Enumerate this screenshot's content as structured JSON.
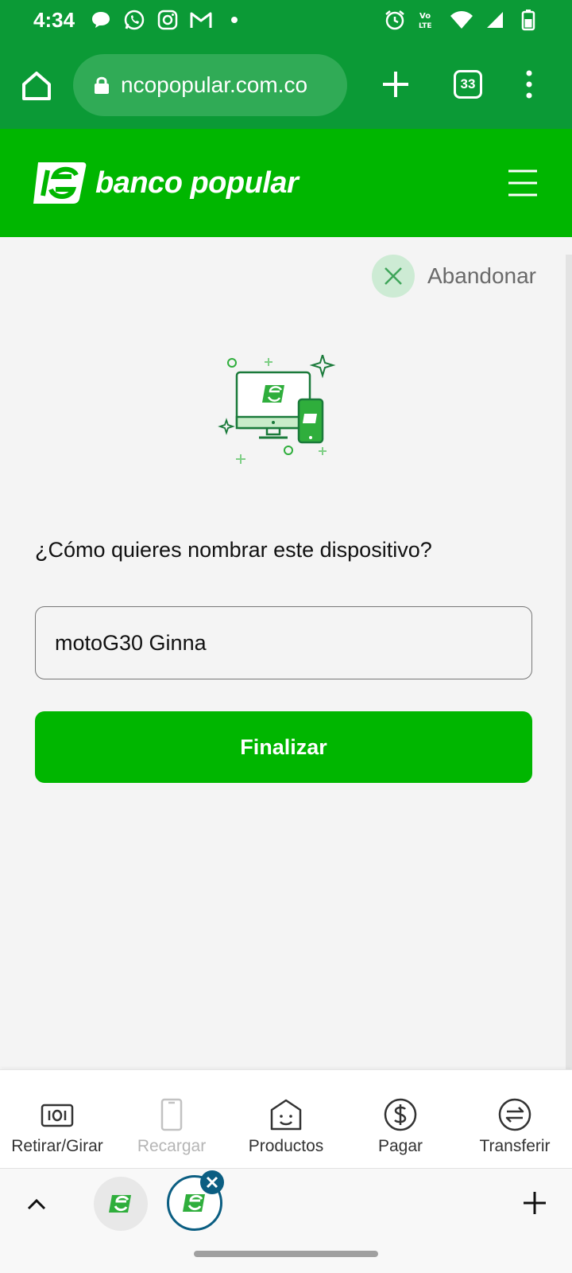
{
  "status_bar": {
    "time": "4:34",
    "left_icons": [
      "chat-bubble-icon",
      "whatsapp-icon",
      "instagram-icon",
      "gmail-icon",
      "dot-icon"
    ],
    "right_icons": [
      "alarm-icon",
      "volte-icon",
      "wifi-icon",
      "signal-icon",
      "battery-icon"
    ],
    "volte_label": "VoLTE"
  },
  "browser": {
    "url": "ncopopular.com.co",
    "tab_count": "33"
  },
  "site_header": {
    "brand_name": "banco popular"
  },
  "main": {
    "abandon_label": "Abandonar",
    "question": "¿Cómo quieres nombrar este dispositivo?",
    "device_name_value": "motoG30 Ginna",
    "finish_label": "Finalizar"
  },
  "bottom_nav": {
    "items": [
      {
        "label": "Retirar/Girar",
        "icon": "cash-icon",
        "enabled": true
      },
      {
        "label": "Recargar",
        "icon": "phone-icon",
        "enabled": false
      },
      {
        "label": "Productos",
        "icon": "bag-smile-icon",
        "enabled": true
      },
      {
        "label": "Pagar",
        "icon": "dollar-circle-icon",
        "enabled": true
      },
      {
        "label": "Transferir",
        "icon": "transfer-icon",
        "enabled": true
      }
    ]
  },
  "colors": {
    "browser_green": "#0b9a36",
    "brand_green": "#00b600",
    "page_bg": "#f4f4f4",
    "tab_accent": "#0b5e82"
  }
}
